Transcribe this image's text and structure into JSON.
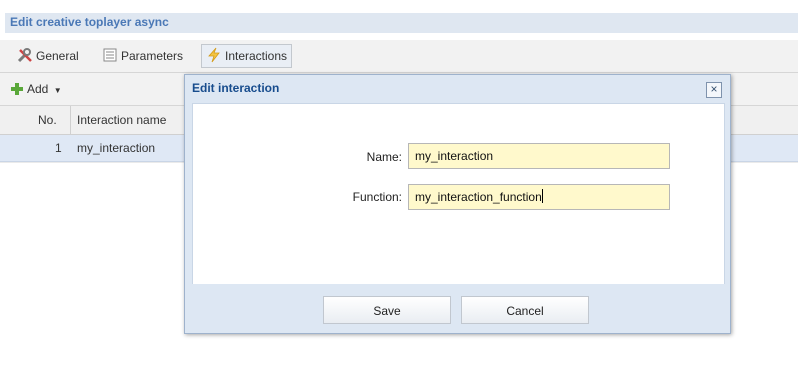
{
  "window": {
    "title": "Edit creative toplayer async"
  },
  "tabs": [
    {
      "label": "General",
      "icon": "tools-icon"
    },
    {
      "label": "Parameters",
      "icon": "document-icon"
    },
    {
      "label": "Interactions",
      "icon": "lightning-icon",
      "active": true
    }
  ],
  "toolbar": {
    "add_label": "Add"
  },
  "grid": {
    "columns": [
      "No.",
      "Interaction name"
    ],
    "rows": [
      {
        "no": "1",
        "name": "my_interaction"
      }
    ]
  },
  "dialog": {
    "title": "Edit interaction",
    "name_label": "Name:",
    "name_value": "my_interaction",
    "function_label": "Function:",
    "function_value": "my_interaction_function",
    "save_label": "Save",
    "cancel_label": "Cancel"
  },
  "colors": {
    "accent": "#4a78b6",
    "dialog_bg": "#dde7f3",
    "field_bg": "#fff9cc",
    "selected_row": "#dfe8f5"
  }
}
